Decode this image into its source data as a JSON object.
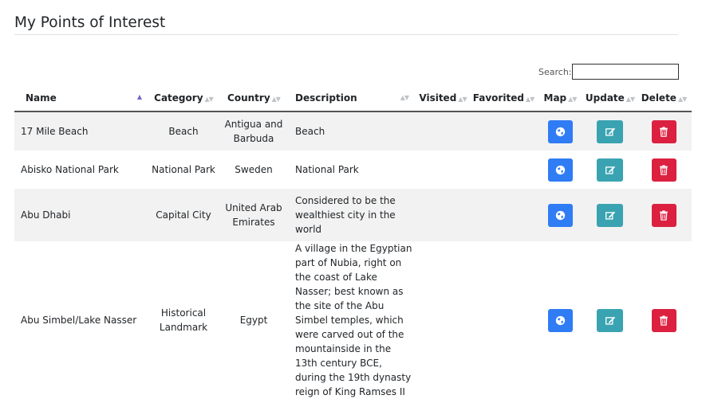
{
  "page": {
    "title": "My Points of Interest"
  },
  "search": {
    "label": "Search:",
    "value": ""
  },
  "table": {
    "headers": {
      "name": "Name",
      "category": "Category",
      "country": "Country",
      "description": "Description",
      "visited": "Visited",
      "favorited": "Favorited",
      "map": "Map",
      "update": "Update",
      "delete": "Delete"
    },
    "sort": {
      "column": "Name",
      "direction": "ascending"
    },
    "rows": [
      {
        "name": "17 Mile Beach",
        "category": "Beach",
        "country": "Antigua and Barbuda",
        "description": "Beach",
        "visited": "",
        "favorited": ""
      },
      {
        "name": "Abisko National Park",
        "category": "National Park",
        "country": "Sweden",
        "description": "National Park",
        "visited": "",
        "favorited": ""
      },
      {
        "name": "Abu Dhabi",
        "category": "Capital City",
        "country": "United Arab Emirates",
        "description": "Considered to be the wealthiest city in the world",
        "visited": "",
        "favorited": ""
      },
      {
        "name": "Abu Simbel/Lake Nasser",
        "category": "Historical Landmark",
        "country": "Egypt",
        "description": "A village in the Egyptian part of Nubia, right on the coast of Lake Nasser; best known as the site of the Abu Simbel temples, which were carved out of the mountainside in the 13th century BCE, during the 19th dynasty reign of King Ramses II",
        "visited": "",
        "favorited": ""
      }
    ]
  },
  "icons": {
    "map": "globe-icon",
    "update": "edit-icon",
    "delete": "trash-icon"
  },
  "colors": {
    "map_button": "#2f7cf5",
    "update_button": "#3aa3b1",
    "delete_button": "#dc2040",
    "sort_active": "#7765c9"
  }
}
